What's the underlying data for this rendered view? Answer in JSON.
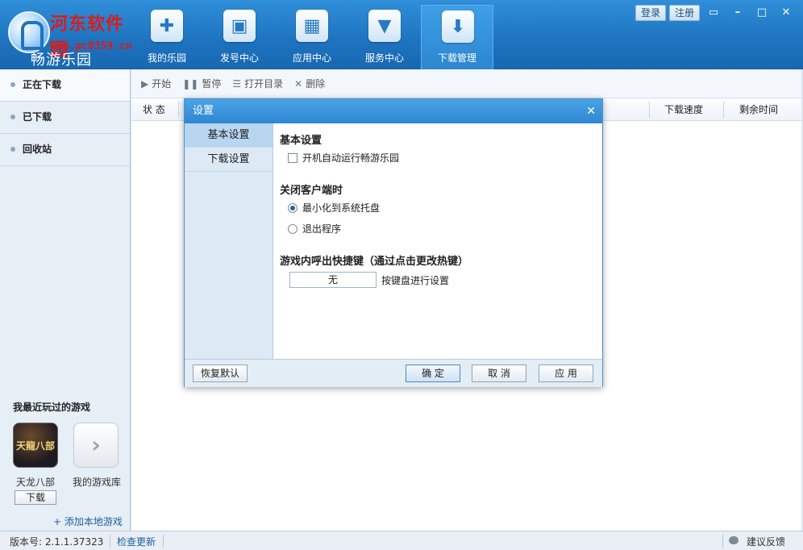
{
  "header": {
    "watermark": "河东软件园",
    "watermark_url": "www.pc0359.cn",
    "app_name": "畅游乐园",
    "nav": [
      {
        "label": "我的乐园",
        "icon": "gamepad-icon"
      },
      {
        "label": "发号中心",
        "icon": "gift-icon"
      },
      {
        "label": "应用中心",
        "icon": "apps-grid-icon"
      },
      {
        "label": "服务中心",
        "icon": "tie-icon"
      },
      {
        "label": "下载管理",
        "icon": "download-icon"
      }
    ],
    "login": "登录",
    "register": "注册"
  },
  "sidebar": {
    "items": [
      {
        "label": "正在下载"
      },
      {
        "label": "已下载"
      },
      {
        "label": "回收站"
      }
    ],
    "recent_title": "我最近玩过的游戏",
    "game1_name": "天龙八部",
    "game1_icon_text": "天龍八部",
    "game2_name": "我的游戏库",
    "download_btn": "下载",
    "add_local": "+ 添加本地游戏"
  },
  "toolbar": {
    "start": "开始",
    "pause": "暂停",
    "open_dir": "打开目录",
    "delete": "删除"
  },
  "columns": {
    "status": "状 态",
    "speed": "下载速度",
    "remaining": "剩余时间"
  },
  "dialog": {
    "title": "设置",
    "tabs": [
      {
        "label": "基本设置"
      },
      {
        "label": "下载设置"
      }
    ],
    "basic_heading": "基本设置",
    "autorun_label": "开机自动运行畅游乐园",
    "close_heading": "关闭客户端时",
    "minimize_label": "最小化到系统托盘",
    "exit_label": "退出程序",
    "hotkey_heading": "游戏内呼出快捷键（通过点击更改热键）",
    "hotkey_value": "无",
    "hotkey_hint": "按键盘进行设置",
    "restore_btn": "恢复默认",
    "ok_btn": "确 定",
    "cancel_btn": "取 消",
    "apply_btn": "应 用"
  },
  "statusbar": {
    "version": "版本号: 2.1.1.37323",
    "check_update": "检查更新",
    "feedback": "建议反馈"
  }
}
